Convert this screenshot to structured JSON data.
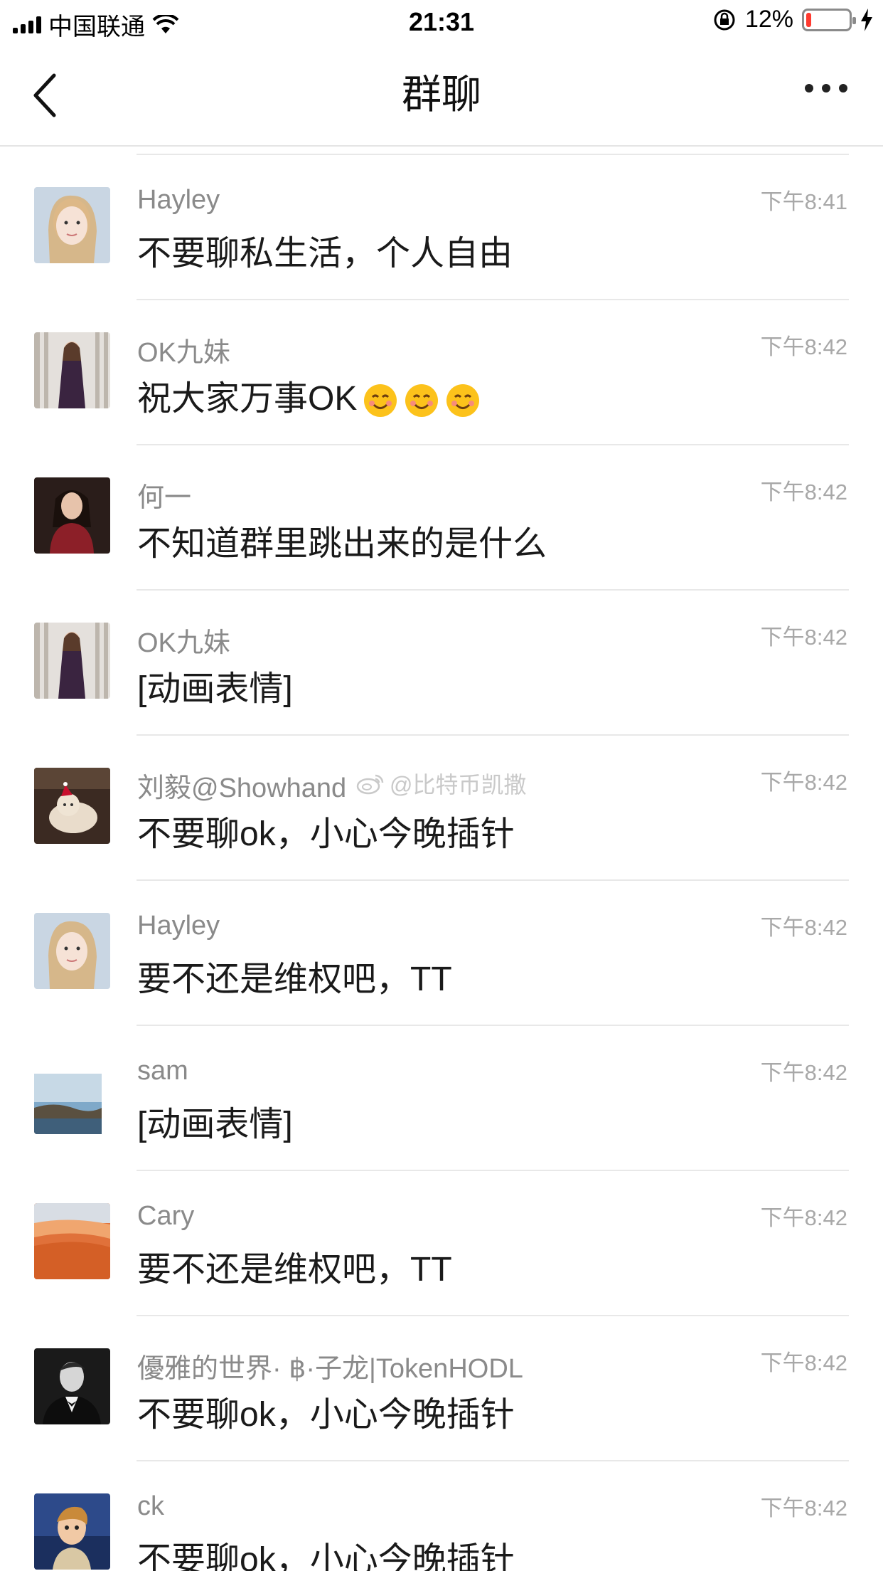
{
  "status_bar": {
    "carrier": "中国联通",
    "time": "21:31",
    "battery_percent": "12%",
    "battery_level": 0.12
  },
  "nav": {
    "title": "群聊"
  },
  "watermark": "@比特币凯撒",
  "messages": [
    {
      "sender": "Hayley",
      "time": "下午8:41",
      "text": "不要聊私生活，个人自由"
    },
    {
      "sender": "OK九妹",
      "time": "下午8:42",
      "text": "祝大家万事OK",
      "emoji_count": 3
    },
    {
      "sender": "何一",
      "time": "下午8:42",
      "text": "不知道群里跳出来的是什么"
    },
    {
      "sender": "OK九妹",
      "time": "下午8:42",
      "text": "[动画表情]"
    },
    {
      "sender": "刘毅@Showhand",
      "time": "下午8:42",
      "text": "不要聊ok，小心今晚插针"
    },
    {
      "sender": "Hayley",
      "time": "下午8:42",
      "text": "要不还是维权吧，TT"
    },
    {
      "sender": "sam",
      "time": "下午8:42",
      "text": "[动画表情]"
    },
    {
      "sender": "Cary",
      "time": "下午8:42",
      "text": "要不还是维权吧，TT"
    },
    {
      "sender": "優雅的世界· ฿·子龙|TokenHODL",
      "time": "下午8:42",
      "text": "不要聊ok，小心今晚插针"
    },
    {
      "sender": "ck",
      "time": "下午8:42",
      "text": "不要聊ok，小心今晚插针"
    }
  ]
}
